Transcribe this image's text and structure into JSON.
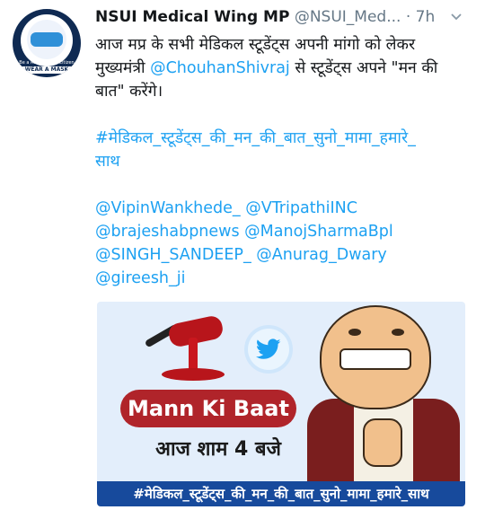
{
  "tweet": {
    "author_name": "NSUI Medical Wing MP",
    "handle": "@NSUI_Med...",
    "dot": "·",
    "time": "7h",
    "lines": [
      {
        "parts": [
          {
            "text": "आज मप्र के सभी मेडिकल स्टूडेंट्स अपनी मांगो को लेकर",
            "link": false
          }
        ]
      },
      {
        "parts": [
          {
            "text": "मुख्यमंत्री ",
            "link": false
          },
          {
            "text": "@ChouhanShivraj",
            "link": true
          },
          {
            "text": " से स्टूडेंट्स अपने \"मन की",
            "link": false
          }
        ]
      },
      {
        "parts": [
          {
            "text": "बात\" करेंगे।",
            "link": false
          }
        ]
      }
    ],
    "hashtag_lines": [
      "#मेडिकल_स्टूडेंट्स_की_मन_की_बात_सुनो_मामा_हमारे_",
      "साथ"
    ],
    "mention_lines": [
      [
        "@VipinWankhede_",
        "@VTripathiINC"
      ],
      [
        "@brajeshabpnews",
        "@ManojSharmaBpl"
      ],
      [
        "@SINGH_SANDEEP_",
        "@Anurag_Dwary"
      ],
      [
        "@gireesh_ji"
      ]
    ]
  },
  "avatar": {
    "tagline": "Be a Responsible Citizen",
    "wear_text": "WEAR A MASK"
  },
  "card": {
    "pill_text": "Mann Ki Baat",
    "subtitle": "आज शाम 4 बजे",
    "banner": "#मेडिकल_स्टूडेंट्स_की_मन_की_बात_सुनो_मामा_हमारे_साथ"
  },
  "colors": {
    "link": "#1da1f2",
    "muted": "#657786",
    "pill": "#b0242a",
    "banner": "#174a9c"
  },
  "icons": {
    "more": "chevron-down-icon",
    "bird": "twitter-bird-icon"
  }
}
